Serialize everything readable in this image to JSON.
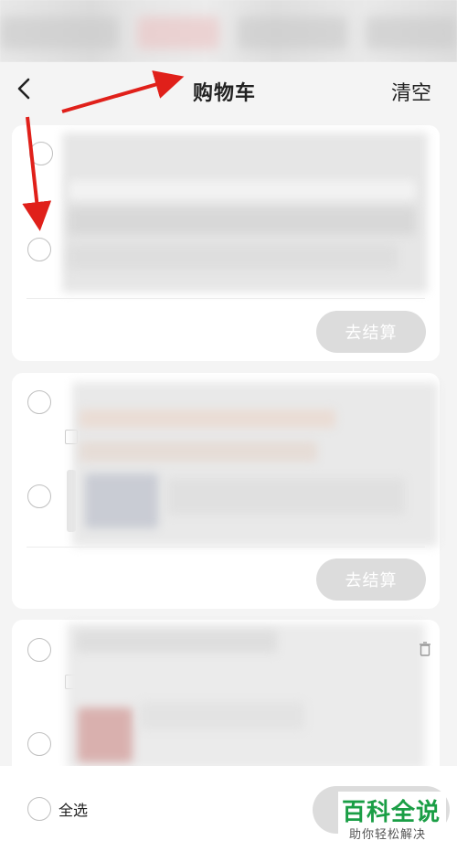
{
  "header": {
    "title": "购物车",
    "clear_label": "清空",
    "back_icon": "chevron-left-icon"
  },
  "cards": [
    {
      "checkout_label": "去结算"
    },
    {
      "checkout_label": "去结算"
    },
    {
      "checkout_label": ""
    }
  ],
  "footer": {
    "select_all_label": "全选"
  },
  "watermark": {
    "brand": "百科全说",
    "sub": "助你轻松解决"
  },
  "colors": {
    "arrow": "#e0201a",
    "brand_green": "#1a9e45",
    "disabled_button": "#dcdcdc"
  }
}
